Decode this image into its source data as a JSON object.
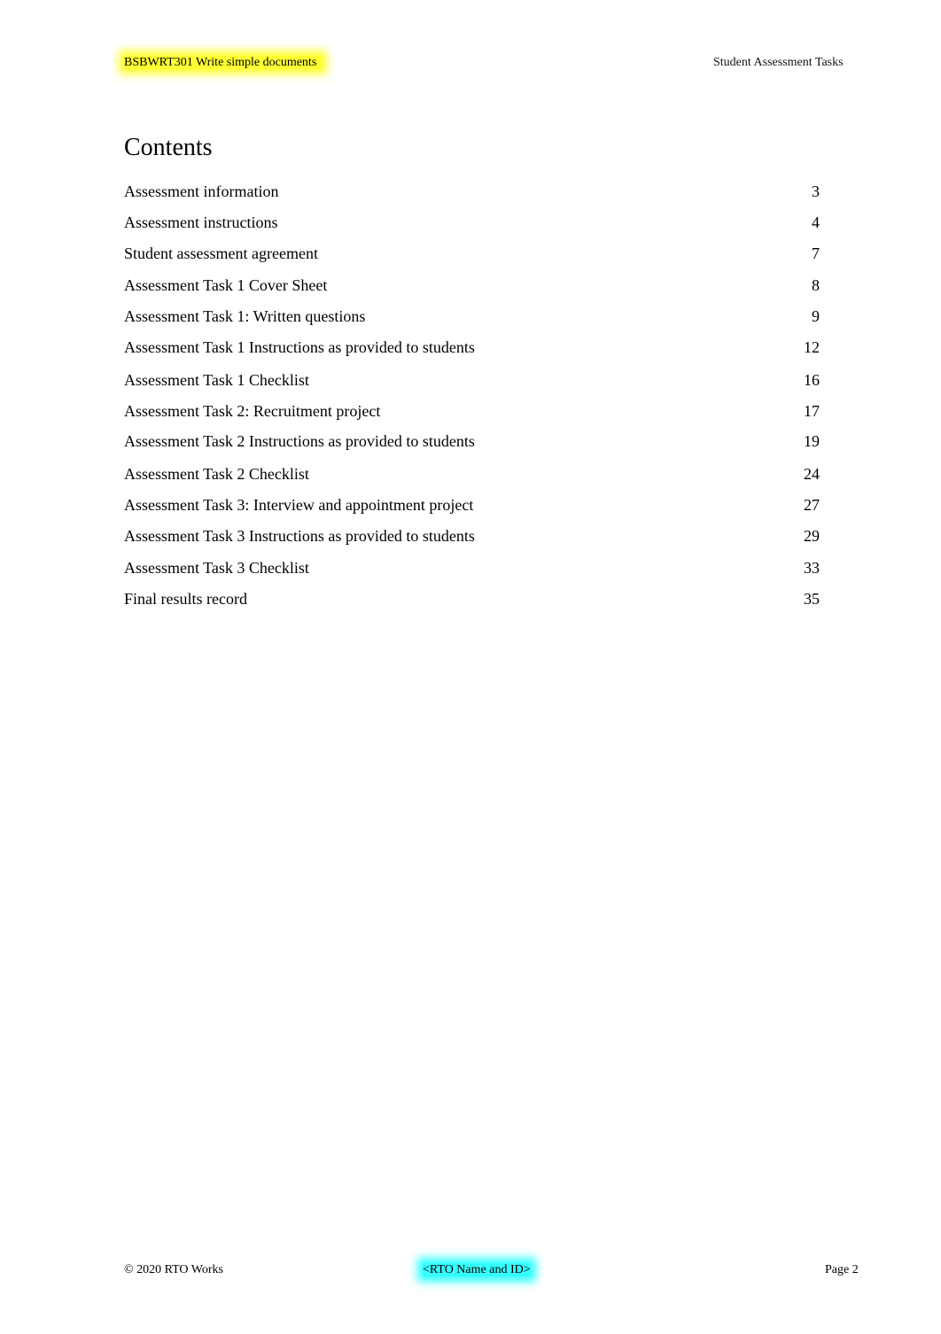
{
  "header": {
    "left": "BSBWRT301 Write simple documents",
    "right": "Student Assessment Tasks",
    "left_highlight_color": "#ffff33"
  },
  "toc": {
    "title": "Contents",
    "items": [
      {
        "label": "Assessment information",
        "page": "3"
      },
      {
        "label": "Assessment instructions",
        "page": "4"
      },
      {
        "label": "Student assessment agreement",
        "page": "7"
      },
      {
        "label": "Assessment Task 1 Cover Sheet",
        "page": "8"
      },
      {
        "label": "Assessment Task 1: Written questions",
        "page": "9"
      },
      {
        "label": "Assessment Task 1 Instructions as provided to students",
        "page": "12"
      },
      {
        "label": "Assessment Task 1 Checklist",
        "page": "16"
      },
      {
        "label": "Assessment Task 2: Recruitment project",
        "page": "17"
      },
      {
        "label": "Assessment Task 2 Instructions as provided to students",
        "page": "19"
      },
      {
        "label": "Assessment Task 2 Checklist",
        "page": "24"
      },
      {
        "label": "Assessment Task 3: Interview and appointment project",
        "page": "27"
      },
      {
        "label": "Assessment Task 3 Instructions as provided to students",
        "page": "29"
      },
      {
        "label": "Assessment Task 3 Checklist",
        "page": "33"
      },
      {
        "label": "Final results record",
        "page": "35"
      }
    ]
  },
  "footer": {
    "copyright": "© 2020 RTO Works",
    "rto": "<RTO Name and ID>",
    "page": "Page 2",
    "rto_highlight_color": "#33ffff"
  }
}
